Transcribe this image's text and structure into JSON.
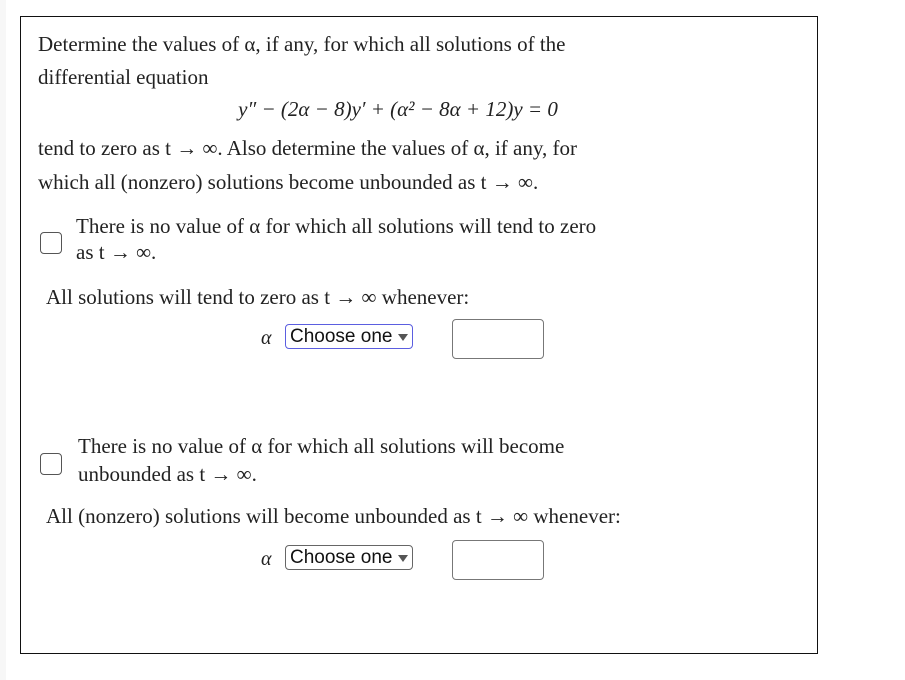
{
  "question": {
    "line1": "Determine the values of α, if any, for which all solutions of the",
    "line2": "differential equation",
    "equation": "y″ − (2α − 8)y′ + (α² − 8α + 12)y = 0",
    "line3": "tend to zero as t → ∞. Also determine the values of α, if any, for",
    "line4": "which all (nonzero) solutions become unbounded as t → ∞."
  },
  "part_zero": {
    "checkbox_label_line1": "There is no value of α for which all solutions will tend to zero",
    "checkbox_label_line2": "as t → ∞.",
    "checked": false,
    "statement": "All solutions will tend to zero as t → ∞ whenever:",
    "variable": "α",
    "select_value": "Choose one",
    "answer_value": ""
  },
  "part_unbounded": {
    "checkbox_label_line1": "There is no value of α for which all solutions will become",
    "checkbox_label_line2": "unbounded as t → ∞.",
    "checked": false,
    "statement": "All (nonzero) solutions will become unbounded as t → ∞ whenever:",
    "variable": "α",
    "select_value": "Choose one",
    "answer_value": ""
  },
  "colors": {
    "focus_border": "#5b5ee0",
    "panel_border": "#111111"
  }
}
